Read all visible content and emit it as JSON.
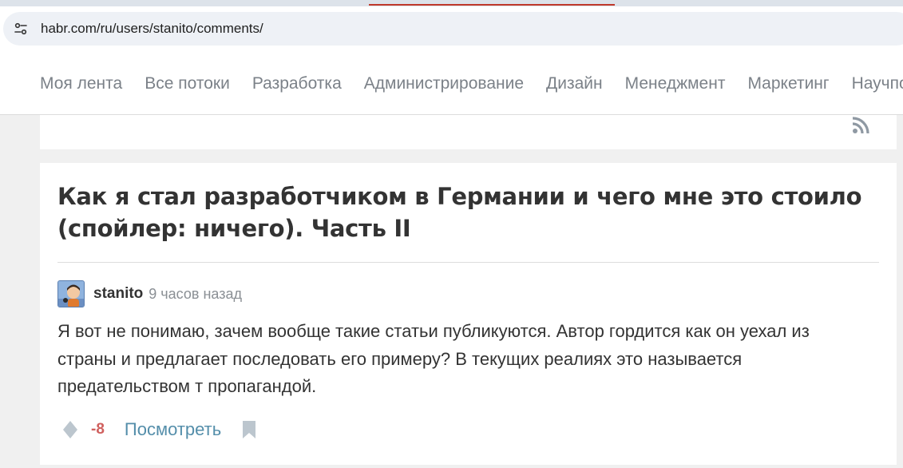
{
  "browser": {
    "url": "habr.com/ru/users/stanito/comments/",
    "site_info_icon": "tune-icon",
    "accent_color": "#c0392b"
  },
  "nav": {
    "items": [
      "Моя лента",
      "Все потоки",
      "Разработка",
      "Администрирование",
      "Дизайн",
      "Менеджмент",
      "Маркетинг",
      "Научпоп"
    ]
  },
  "rss": {
    "icon": "rss-icon"
  },
  "post": {
    "title": "Как я стал разработчиком в Германии и чего мне это стоило (спойлер: ничего). Часть II"
  },
  "comment": {
    "author": "stanito",
    "time": "9 часов назад",
    "text": "Я вот не понимаю, зачем вообще такие статьи публикуются. Автор гордится как он уехал из страны и предлагает последовать его примеру? В текущих реалиях это называется предательством т пропагандой.",
    "score": "-8",
    "score_color": "#d0605e",
    "view_label": "Посмотреть",
    "link_color": "#548eaa"
  }
}
